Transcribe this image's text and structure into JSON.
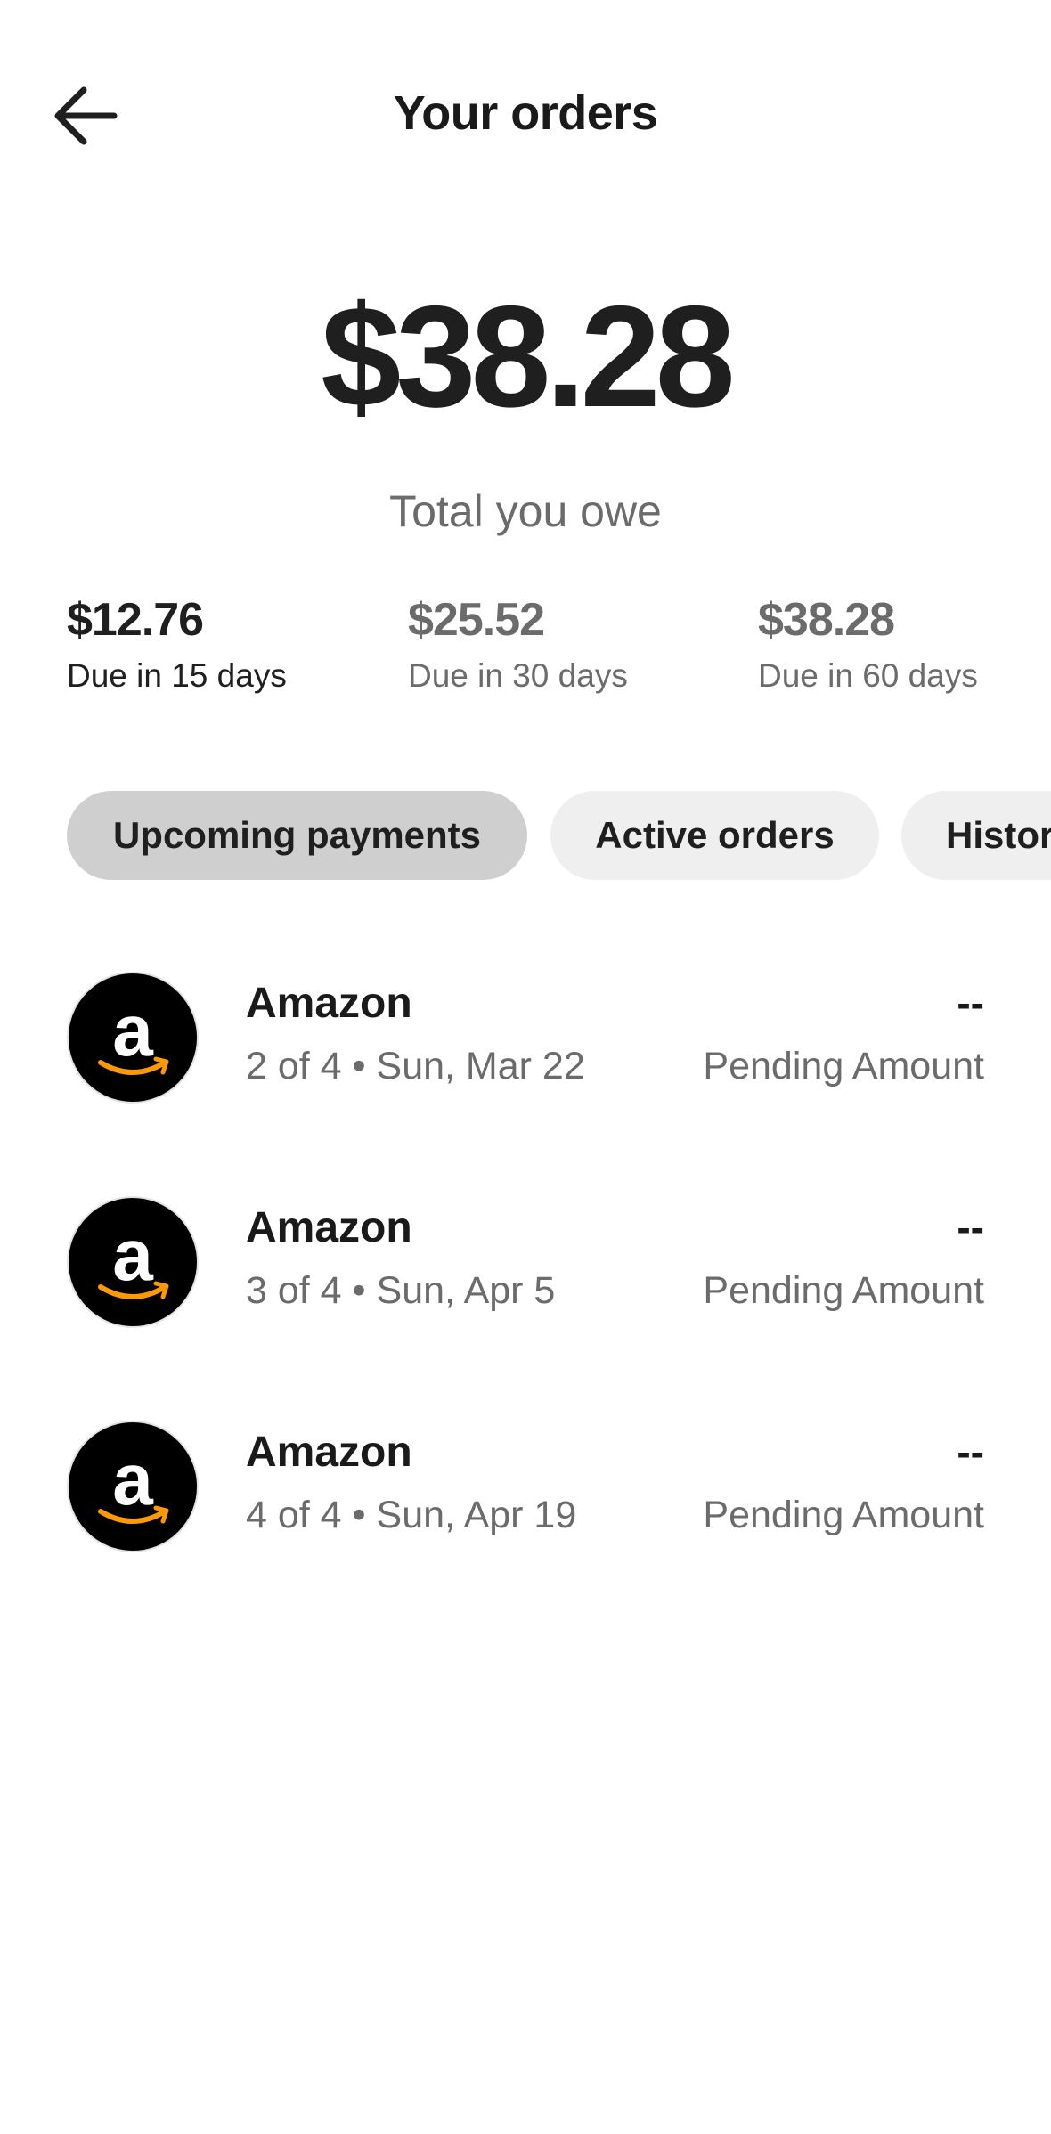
{
  "header": {
    "title": "Your orders",
    "back_icon": "arrow-left-icon"
  },
  "summary": {
    "total_amount": "$38.28",
    "total_label": "Total you owe"
  },
  "due": [
    {
      "amount": "$12.76",
      "label": "Due in 15 days",
      "active": true
    },
    {
      "amount": "$25.52",
      "label": "Due in 30 days",
      "active": false
    },
    {
      "amount": "$38.28",
      "label": "Due in 60 days",
      "active": false
    }
  ],
  "tabs": [
    {
      "label": "Upcoming payments",
      "selected": true
    },
    {
      "label": "Active orders",
      "selected": false
    },
    {
      "label": "History",
      "selected": false
    }
  ],
  "orders": [
    {
      "merchant": "Amazon",
      "meta": "2 of 4 • Sun, Mar 22",
      "amount": "--",
      "status": "Pending Amount",
      "logo_icon": "amazon-logo-icon"
    },
    {
      "merchant": "Amazon",
      "meta": "3 of 4 • Sun, Apr 5",
      "amount": "--",
      "status": "Pending Amount",
      "logo_icon": "amazon-logo-icon"
    },
    {
      "merchant": "Amazon",
      "meta": "4 of 4 • Sun, Apr 19",
      "amount": "--",
      "status": "Pending Amount",
      "logo_icon": "amazon-logo-icon"
    }
  ],
  "colors": {
    "text_primary": "#1f1f1f",
    "text_secondary": "#6b6b6b",
    "tab_selected_bg": "#cfcfcf",
    "tab_bg": "#efefef",
    "amazon_smile": "#ff9900"
  }
}
